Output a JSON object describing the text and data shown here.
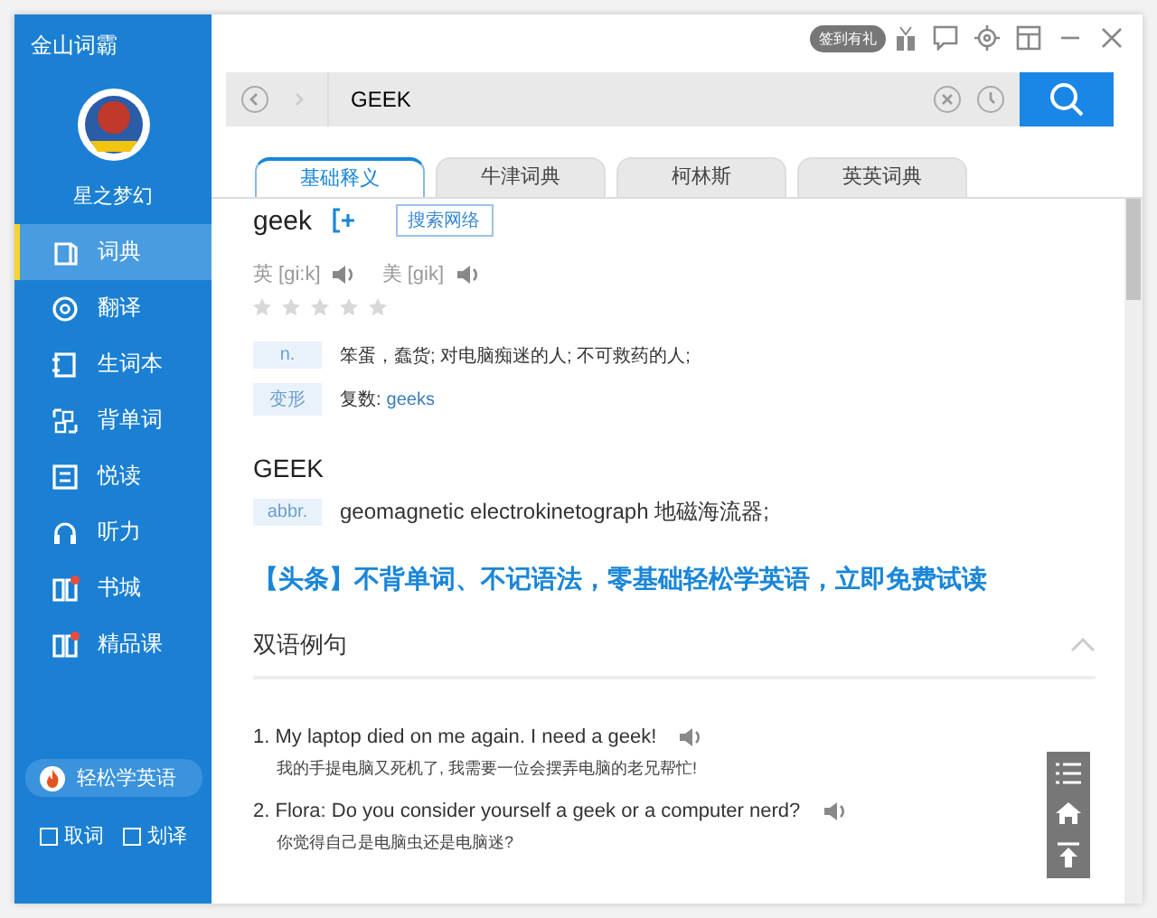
{
  "app": {
    "title": "金山词霸",
    "username": "星之梦幻"
  },
  "nav": [
    {
      "label": "词典",
      "selected": true,
      "badge": false
    },
    {
      "label": "翻译",
      "selected": false,
      "badge": false
    },
    {
      "label": "生词本",
      "selected": false,
      "badge": false
    },
    {
      "label": "背单词",
      "selected": false,
      "badge": false
    },
    {
      "label": "悦读",
      "selected": false,
      "badge": false
    },
    {
      "label": "听力",
      "selected": false,
      "badge": false
    },
    {
      "label": "书城",
      "selected": false,
      "badge": true
    },
    {
      "label": "精品课",
      "selected": false,
      "badge": true
    }
  ],
  "promo": {
    "label": "轻松学英语"
  },
  "options": [
    {
      "label": "取词",
      "checked": false
    },
    {
      "label": "划译",
      "checked": false
    }
  ],
  "top_bar": {
    "signin": "签到有礼"
  },
  "search": {
    "value": "GEEK"
  },
  "tabs": [
    {
      "label": "基础释义",
      "selected": true
    },
    {
      "label": "牛津词典",
      "selected": false
    },
    {
      "label": "柯林斯",
      "selected": false
    },
    {
      "label": "英英词典",
      "selected": false
    }
  ],
  "entry": {
    "word": "geek",
    "web_search": "搜索网络",
    "stars": 0,
    "pronunciations": [
      {
        "label": "英 [gi:k]"
      },
      {
        "label": "美 [gik]"
      }
    ],
    "definitions": [
      {
        "pos": "n.",
        "kind": "plain",
        "text": "笨蛋，蠢货; 对电脑痴迷的人; 不可救药的人;"
      },
      {
        "pos": "变形",
        "kind": "link",
        "text": "复数:",
        "link": "geeks"
      }
    ]
  },
  "abbreviation": {
    "word": "GEEK",
    "pos": "abbr.",
    "text": "geomagnetic electrokinetograph 地磁海流器;"
  },
  "headline": "【头条】不背单词、不记语法，零基础轻松学英语，立即免费试读",
  "examples": {
    "title": "双语例句",
    "expanded": true,
    "items": [
      {
        "en": "1. My laptop died on me again. I need a geek!",
        "zh": "我的手提电脑又死机了, 我需要一位会摆弄电脑的老兄帮忙!"
      },
      {
        "en": "2. Flora: Do you consider yourself a geek or a computer nerd?",
        "zh": "你觉得自己是电脑虫还是电脑迷?"
      }
    ]
  }
}
